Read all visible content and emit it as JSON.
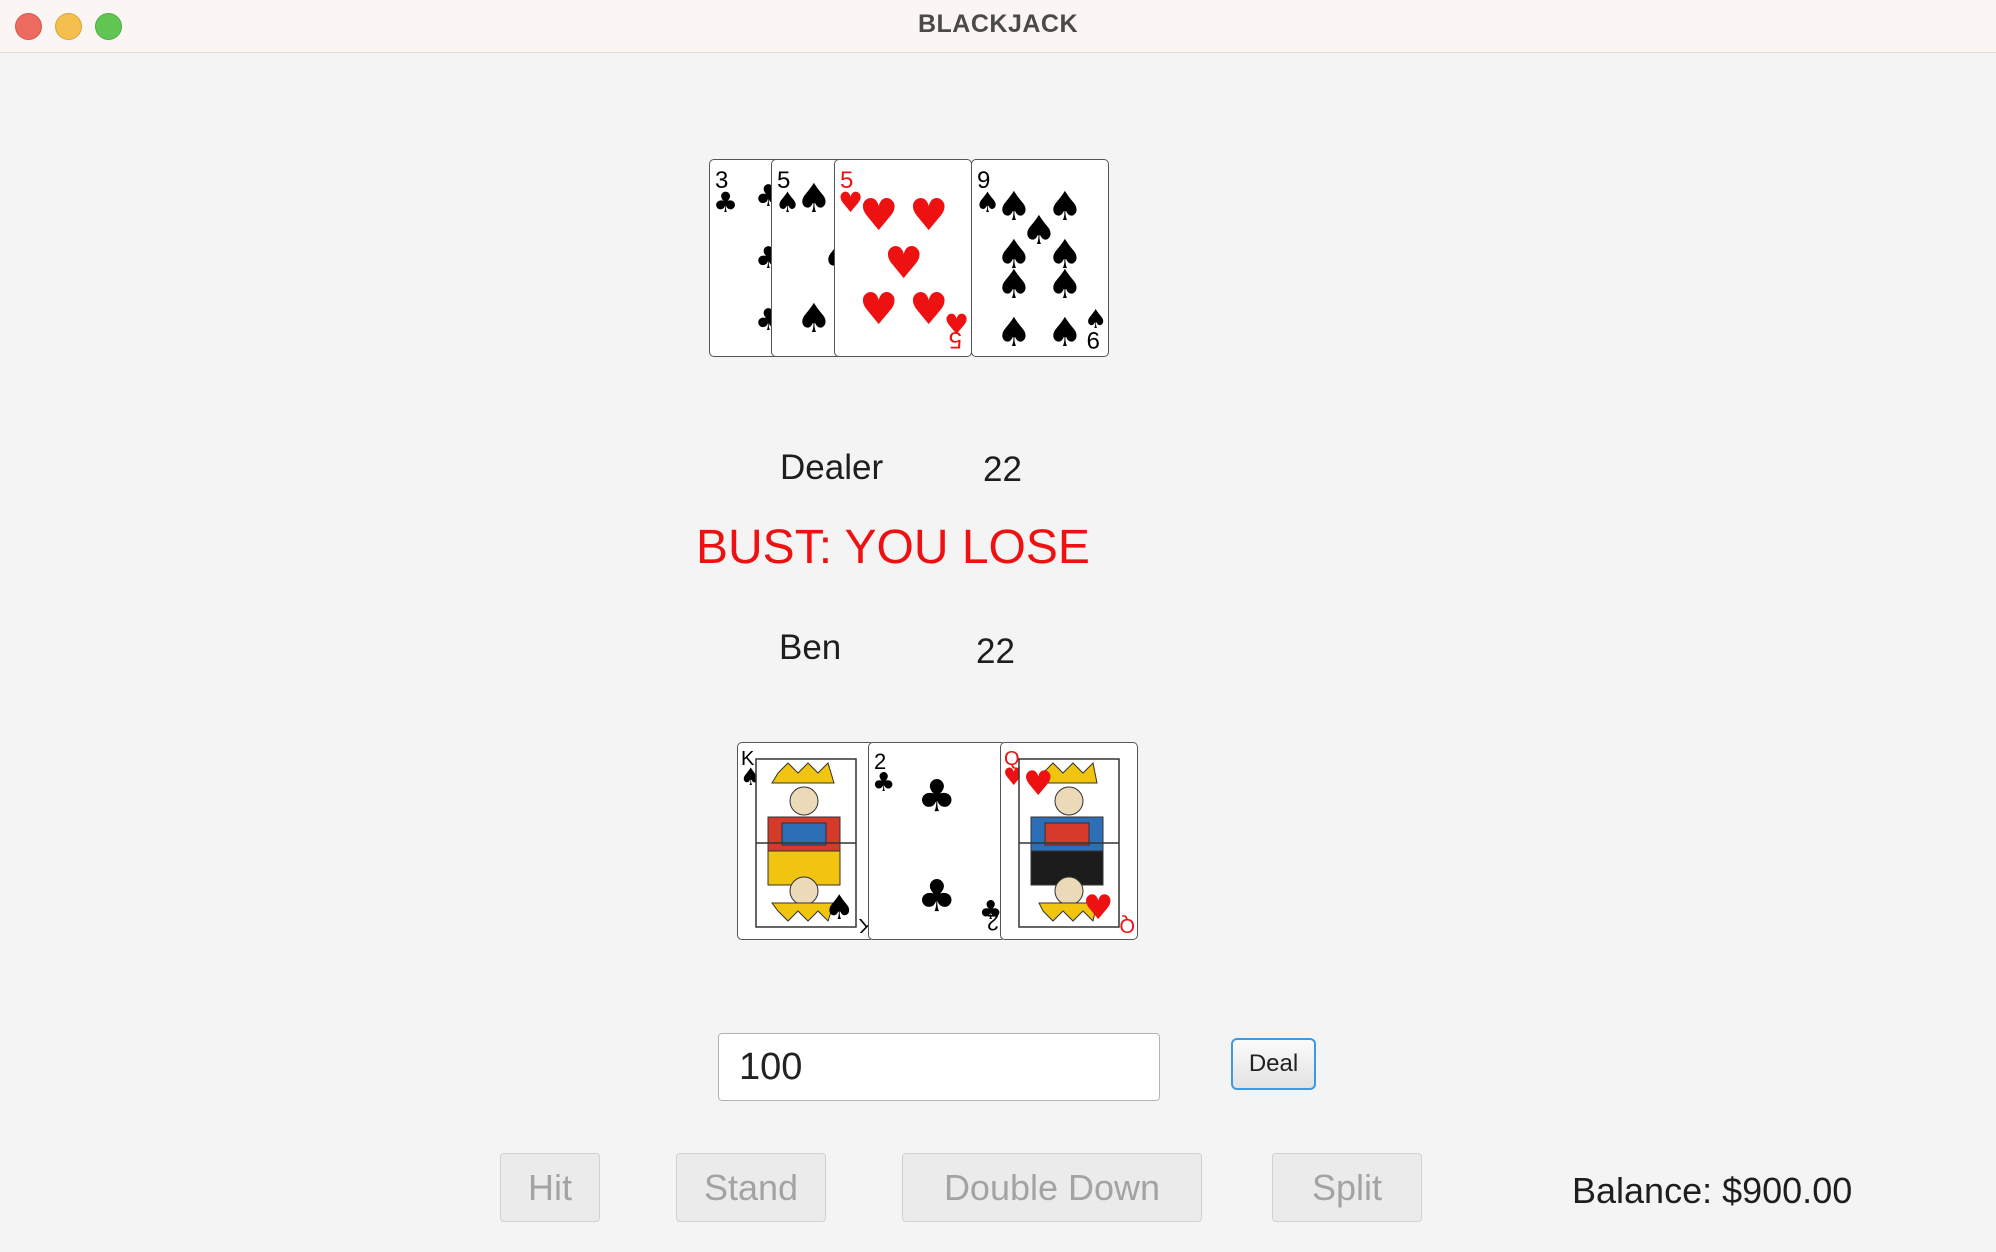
{
  "window": {
    "title": "BLACKJACK"
  },
  "dealer": {
    "name": "Dealer",
    "score": "22",
    "cards": [
      {
        "rank": "3",
        "suit": "♣",
        "color": "#000000"
      },
      {
        "rank": "5",
        "suit": "♠",
        "color": "#000000"
      },
      {
        "rank": "5",
        "suit": "♥",
        "color": "#ee1111"
      },
      {
        "rank": "9",
        "suit": "♠",
        "color": "#000000"
      }
    ]
  },
  "result": "BUST: YOU LOSE",
  "player": {
    "name": "Ben",
    "score": "22",
    "cards": [
      {
        "rank": "K",
        "suit": "♠",
        "color": "#000000"
      },
      {
        "rank": "2",
        "suit": "♣",
        "color": "#000000"
      },
      {
        "rank": "Q",
        "suit": "♥",
        "color": "#ee1111"
      }
    ]
  },
  "bet_input": {
    "value": "100"
  },
  "deal_label": "Deal",
  "actions": {
    "hit": "Hit",
    "stand": "Stand",
    "double_down": "Double Down",
    "split": "Split"
  },
  "balance": "Balance: $900.00",
  "colors": {
    "result": "#ef1111",
    "focus": "#3b9ae6"
  }
}
